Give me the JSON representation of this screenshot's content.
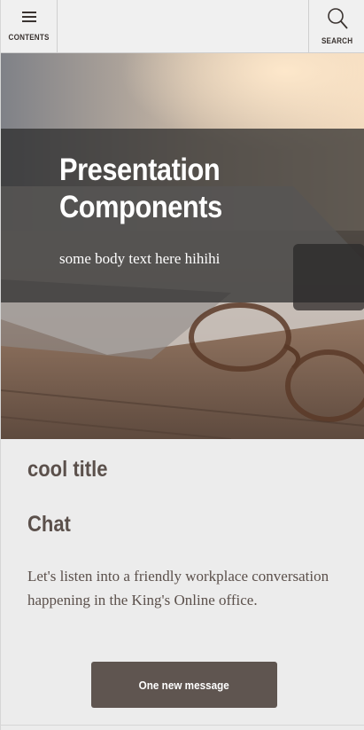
{
  "topbar": {
    "contents_label": "CONTENTS",
    "search_label": "SEARCH",
    "menu_icon": "hamburger-icon",
    "search_icon": "search-icon"
  },
  "hero": {
    "title": "Presentation Components",
    "body": "some body text here hihihi",
    "image_description_icon": "laptop-glasses-photo"
  },
  "content": {
    "cool_title": "cool title",
    "chat_title": "Chat",
    "chat_body": "Let's listen into a friendly workplace conversation happening in the King's Online office.",
    "message_button": "One new message"
  },
  "colors": {
    "text": "#5b504b",
    "button_bg": "#5f5550",
    "background": "#ececec"
  }
}
